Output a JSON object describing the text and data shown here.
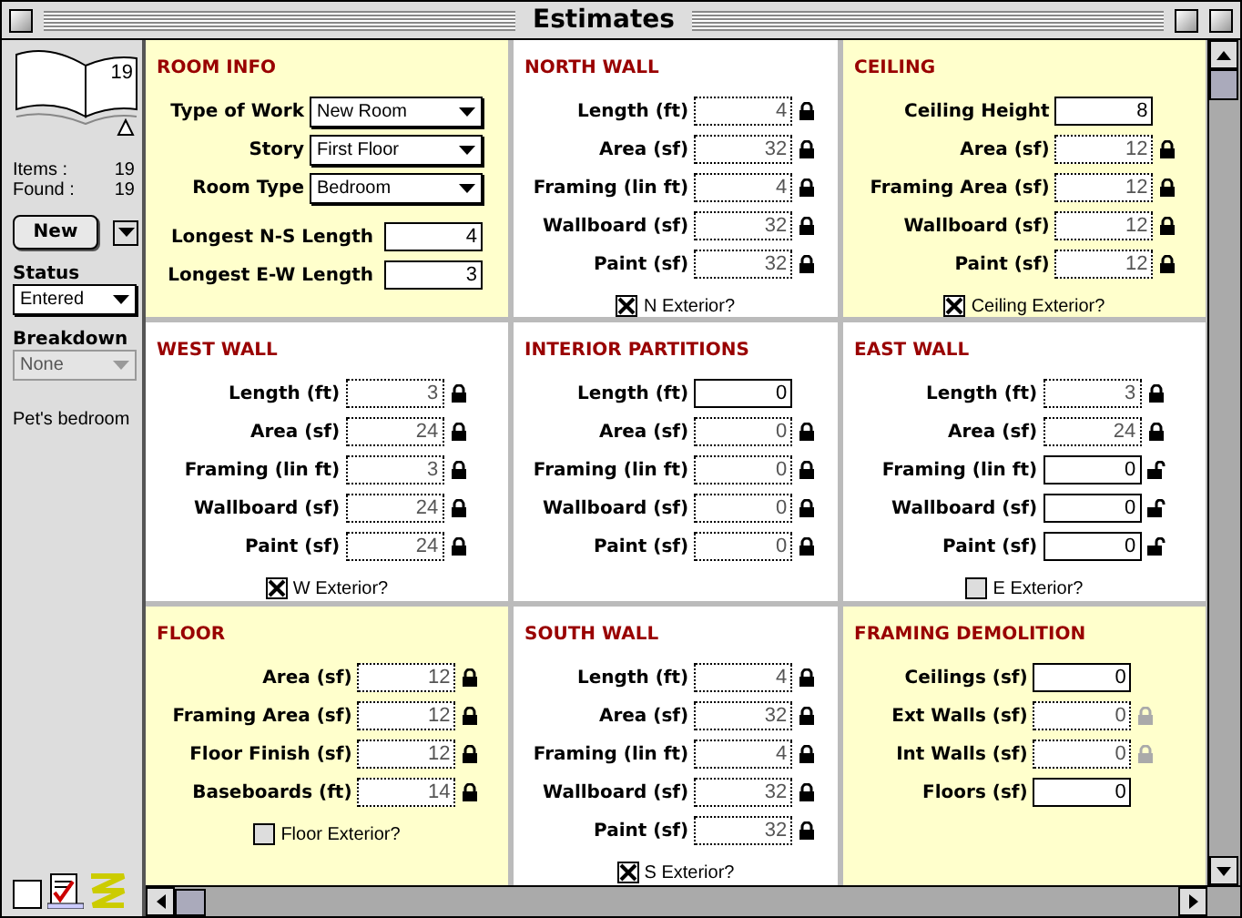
{
  "window": {
    "title": "Estimates"
  },
  "sidebar": {
    "record_count": "19",
    "stats": [
      {
        "label": "Items :",
        "value": "19"
      },
      {
        "label": "Found :",
        "value": "19"
      }
    ],
    "new_button": "New",
    "status": {
      "label": "Status",
      "value": "Entered",
      "disabled": false
    },
    "breakdown": {
      "label": "Breakdown",
      "value": "None",
      "disabled": true
    },
    "record_name": "Pet's bedroom"
  },
  "panels": [
    {
      "title": "ROOM INFO",
      "shaded": true,
      "selects": [
        {
          "label": "Type of Work",
          "value": "New Room"
        },
        {
          "label": "Story",
          "value": "First Floor"
        },
        {
          "label": "Room Type",
          "value": "Bedroom"
        }
      ],
      "fields": [
        {
          "label": "Longest N-S Length",
          "value": "4",
          "kind": "entry"
        },
        {
          "label": "Longest E-W Length",
          "value": "3",
          "kind": "entry"
        }
      ]
    },
    {
      "title": "NORTH WALL",
      "shaded": false,
      "fields": [
        {
          "label": "Length (ft)",
          "value": "4",
          "kind": "computed"
        },
        {
          "label": "Area (sf)",
          "value": "32",
          "kind": "computed"
        },
        {
          "label": "Framing (lin ft)",
          "value": "4",
          "kind": "computed"
        },
        {
          "label": "Wallboard (sf)",
          "value": "32",
          "kind": "computed"
        },
        {
          "label": "Paint (sf)",
          "value": "32",
          "kind": "computed"
        }
      ],
      "checkbox": {
        "label": "N Exterior?",
        "checked": true
      }
    },
    {
      "title": "CEILING",
      "shaded": true,
      "fields": [
        {
          "label": "Ceiling Height",
          "value": "8",
          "kind": "entry"
        },
        {
          "label": "Area (sf)",
          "value": "12",
          "kind": "computed"
        },
        {
          "label": "Framing Area (sf)",
          "value": "12",
          "kind": "computed"
        },
        {
          "label": "Wallboard (sf)",
          "value": "12",
          "kind": "computed"
        },
        {
          "label": "Paint (sf)",
          "value": "12",
          "kind": "computed"
        }
      ],
      "checkbox": {
        "label": "Ceiling Exterior?",
        "checked": true
      }
    },
    {
      "title": "WEST WALL",
      "shaded": false,
      "fields": [
        {
          "label": "Length (ft)",
          "value": "3",
          "kind": "computed"
        },
        {
          "label": "Area (sf)",
          "value": "24",
          "kind": "computed"
        },
        {
          "label": "Framing (lin ft)",
          "value": "3",
          "kind": "computed"
        },
        {
          "label": "Wallboard (sf)",
          "value": "24",
          "kind": "computed"
        },
        {
          "label": "Paint (sf)",
          "value": "24",
          "kind": "computed"
        }
      ],
      "checkbox": {
        "label": "W Exterior?",
        "checked": true
      }
    },
    {
      "title": "INTERIOR PARTITIONS",
      "shaded": false,
      "fields": [
        {
          "label": "Length (ft)",
          "value": "0",
          "kind": "entry"
        },
        {
          "label": "Area (sf)",
          "value": "0",
          "kind": "computed"
        },
        {
          "label": "Framing (lin ft)",
          "value": "0",
          "kind": "computed"
        },
        {
          "label": "Wallboard (sf)",
          "value": "0",
          "kind": "computed"
        },
        {
          "label": "Paint (sf)",
          "value": "0",
          "kind": "computed"
        }
      ]
    },
    {
      "title": "EAST WALL",
      "shaded": false,
      "fields": [
        {
          "label": "Length (ft)",
          "value": "3",
          "kind": "computed"
        },
        {
          "label": "Area (sf)",
          "value": "24",
          "kind": "computed"
        },
        {
          "label": "Framing (lin ft)",
          "value": "0",
          "kind": "override"
        },
        {
          "label": "Wallboard (sf)",
          "value": "0",
          "kind": "override"
        },
        {
          "label": "Paint (sf)",
          "value": "0",
          "kind": "override"
        }
      ],
      "checkbox": {
        "label": "E Exterior?",
        "checked": false
      }
    },
    {
      "title": "FLOOR",
      "shaded": true,
      "fields": [
        {
          "label": "Area (sf)",
          "value": "12",
          "kind": "computed"
        },
        {
          "label": "Framing Area (sf)",
          "value": "12",
          "kind": "computed"
        },
        {
          "label": "Floor Finish (sf)",
          "value": "12",
          "kind": "computed"
        },
        {
          "label": "Baseboards (ft)",
          "value": "14",
          "kind": "computed"
        }
      ],
      "checkbox": {
        "label": "Floor Exterior?",
        "checked": false
      }
    },
    {
      "title": "SOUTH WALL",
      "shaded": false,
      "fields": [
        {
          "label": "Length (ft)",
          "value": "4",
          "kind": "computed"
        },
        {
          "label": "Area (sf)",
          "value": "32",
          "kind": "computed"
        },
        {
          "label": "Framing (lin ft)",
          "value": "4",
          "kind": "computed"
        },
        {
          "label": "Wallboard (sf)",
          "value": "32",
          "kind": "computed"
        },
        {
          "label": "Paint (sf)",
          "value": "32",
          "kind": "computed"
        }
      ],
      "checkbox": {
        "label": "S Exterior?",
        "checked": true
      }
    },
    {
      "title": "FRAMING DEMOLITION",
      "shaded": true,
      "fields": [
        {
          "label": "Ceilings (sf)",
          "value": "0",
          "kind": "entry"
        },
        {
          "label": "Ext Walls (sf)",
          "value": "0",
          "kind": "inactive"
        },
        {
          "label": "Int Walls (sf)",
          "value": "0",
          "kind": "inactive"
        },
        {
          "label": "Floors (sf)",
          "value": "0",
          "kind": "entry"
        }
      ]
    }
  ]
}
